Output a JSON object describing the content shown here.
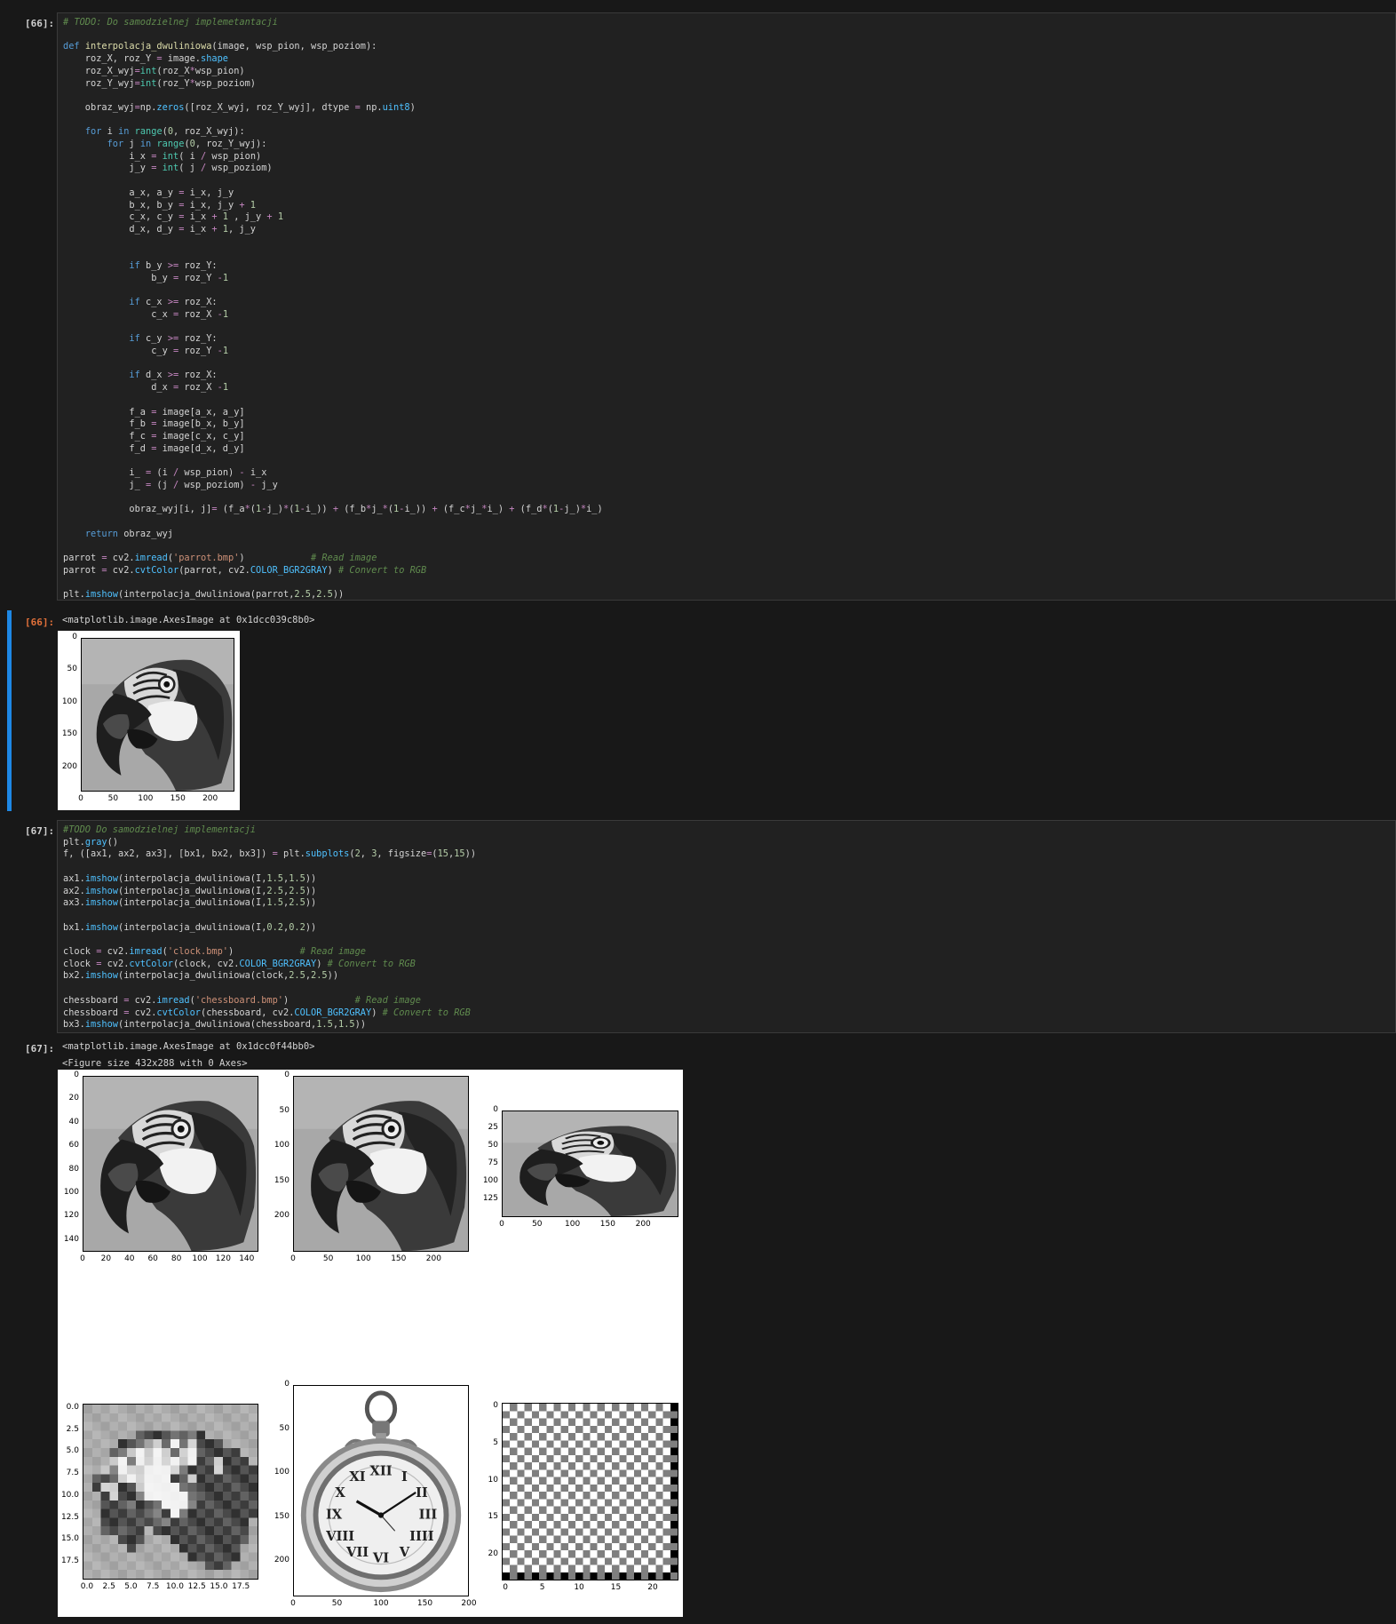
{
  "cells": {
    "c66_in_prompt": "[66]:",
    "c66_out_prompt": "[66]:",
    "c66_out_text": "<matplotlib.image.AxesImage at 0x1dcc039c8b0>",
    "c67_in_prompt": "[67]:",
    "c67_out_prompt": "[67]:",
    "c67_out_text": "<matplotlib.image.AxesImage at 0x1dcc0f44bb0>",
    "c67_fig_text": "<Figure size 432x288 with 0 Axes>"
  },
  "ticks": {
    "p66_y": [
      "0",
      "50",
      "100",
      "150",
      "200"
    ],
    "p66_x": [
      "0",
      "50",
      "100",
      "150",
      "200"
    ],
    "a1_y": [
      "0",
      "20",
      "40",
      "60",
      "80",
      "100",
      "120",
      "140"
    ],
    "a1_x": [
      "0",
      "20",
      "40",
      "60",
      "80",
      "100",
      "120",
      "140"
    ],
    "a2_y": [
      "0",
      "50",
      "100",
      "150",
      "200"
    ],
    "a2_x": [
      "0",
      "50",
      "100",
      "150",
      "200"
    ],
    "a3_y": [
      "0",
      "25",
      "50",
      "75",
      "100",
      "125"
    ],
    "a3_x": [
      "0",
      "50",
      "100",
      "150",
      "200"
    ],
    "b1_y": [
      "0.0",
      "2.5",
      "5.0",
      "7.5",
      "10.0",
      "12.5",
      "15.0",
      "17.5"
    ],
    "b1_x": [
      "0.0",
      "2.5",
      "5.0",
      "7.5",
      "10.0",
      "12.5",
      "15.0",
      "17.5"
    ],
    "b2_y": [
      "0",
      "50",
      "100",
      "150",
      "200"
    ],
    "b2_x": [
      "0",
      "50",
      "100",
      "150",
      "200"
    ],
    "b3_y": [
      "0",
      "5",
      "10",
      "15",
      "20"
    ],
    "b3_x": [
      "0",
      "5",
      "10",
      "15",
      "20"
    ]
  },
  "clock_numerals": [
    "XII",
    "I",
    "II",
    "III",
    "IIII",
    "V",
    "VI",
    "VII",
    "VIII",
    "IX",
    "X",
    "XI"
  ],
  "colors": {
    "accent": "#1e88e5",
    "out_prompt": "#e0703a"
  }
}
